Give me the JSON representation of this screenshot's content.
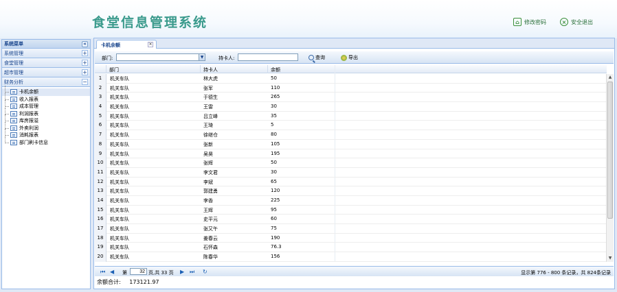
{
  "app": {
    "title": "食堂信息管理系统"
  },
  "header": {
    "change_password": "修改密码",
    "logout": "安全退出"
  },
  "sidebar": {
    "title": "系统菜单",
    "collapse_glyph": "«",
    "sections": [
      {
        "label": "系统管理",
        "toggle": "+"
      },
      {
        "label": "食堂管理",
        "toggle": "+"
      },
      {
        "label": "超市管理",
        "toggle": "+"
      },
      {
        "label": "财务分析",
        "toggle": "−"
      }
    ],
    "items": [
      "卡机余额",
      "收入报表",
      "成本管理",
      "利润报表",
      "库房报溢",
      "外卖利润",
      "消耗报表",
      "部门刷卡信息"
    ]
  },
  "tab": {
    "label": "卡机余额",
    "close": "×"
  },
  "toolbar": {
    "dept_label": "部门:",
    "dept_value": "",
    "cardholder_label": "持卡人:",
    "cardholder_value": "",
    "search_label": "查询",
    "export_label": "导出"
  },
  "grid": {
    "columns": [
      "部门",
      "持卡人",
      "余额"
    ],
    "rows": [
      [
        "1",
        "机关车队",
        "林大虎",
        "50"
      ],
      [
        "2",
        "机关车队",
        "张军",
        "110"
      ],
      [
        "3",
        "机关车队",
        "于德生",
        "265"
      ],
      [
        "4",
        "机关车队",
        "王雷",
        "30"
      ],
      [
        "5",
        "机关车队",
        "吕立峰",
        "35"
      ],
      [
        "6",
        "机关车队",
        "王琦",
        "5"
      ],
      [
        "7",
        "机关车队",
        "徐继仓",
        "80"
      ],
      [
        "8",
        "机关车队",
        "张新",
        "105"
      ],
      [
        "9",
        "机关车队",
        "吴昊",
        "195"
      ],
      [
        "10",
        "机关车队",
        "张辉",
        "50"
      ],
      [
        "11",
        "机关车队",
        "李文君",
        "30"
      ],
      [
        "12",
        "机关车队",
        "李斌",
        "65"
      ],
      [
        "13",
        "机关车队",
        "郭建勇",
        "120"
      ],
      [
        "14",
        "机关车队",
        "李香",
        "225"
      ],
      [
        "15",
        "机关车队",
        "王辉",
        "95"
      ],
      [
        "16",
        "机关车队",
        "史平元",
        "60"
      ],
      [
        "17",
        "机关车队",
        "张又午",
        "75"
      ],
      [
        "18",
        "机关车队",
        "姜春云",
        "190"
      ],
      [
        "19",
        "机关车队",
        "石怀森",
        "76.3"
      ],
      [
        "20",
        "机关车队",
        "陈春华",
        "156"
      ]
    ]
  },
  "pager": {
    "first": "⏮",
    "prev": "◀",
    "page_prefix": "第",
    "page_value": "32",
    "page_suffix": "页,共 33 页",
    "next": "▶",
    "last": "⏭",
    "refresh": "↻",
    "status": "显示第 776 - 800 条记录，共 824条记录"
  },
  "summary": {
    "label": "余额合计:",
    "value": "173121.97"
  }
}
